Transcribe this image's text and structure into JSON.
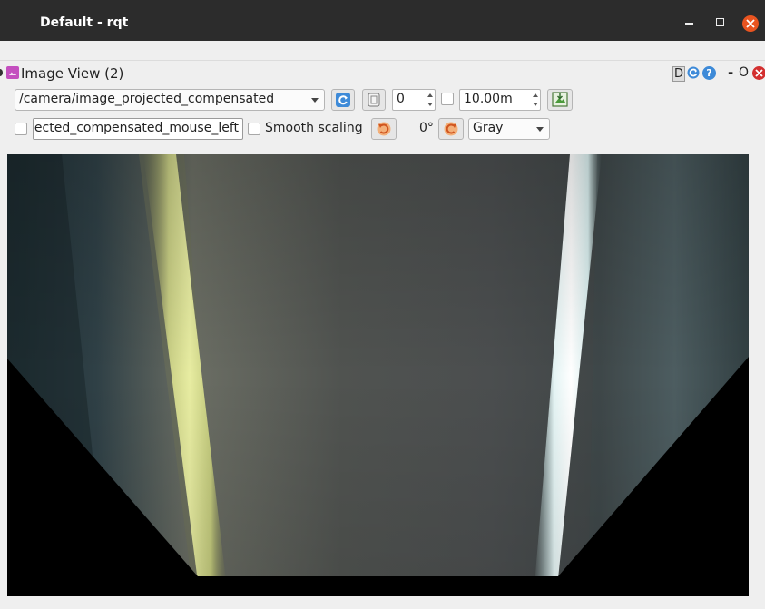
{
  "window": {
    "title": "Default - rqt"
  },
  "plugin": {
    "title": "Image View (2)",
    "header_buttons": {
      "d": "D",
      "dash": "-",
      "o": "O",
      "help": "?"
    }
  },
  "toolbar": {
    "topic": "/camera/image_projected_compensated",
    "spin_value": "0",
    "timeout_value": "10.00m",
    "mouse_topic": "jected_compensated_mouse_left",
    "smooth_scaling_label": "Smooth scaling",
    "rotation": "0°",
    "color_scheme": "Gray"
  },
  "icons": {
    "refresh": "refresh-icon",
    "zoom": "zoom-icon",
    "save": "save-image-icon",
    "rotate_left": "rotate-left-icon",
    "rotate_right": "rotate-right-icon"
  },
  "colors": {
    "titlebar": "#2c2c2c",
    "close": "#e95420",
    "accent_blue": "#3d8ad8",
    "rotate_orange": "#e0662a"
  }
}
